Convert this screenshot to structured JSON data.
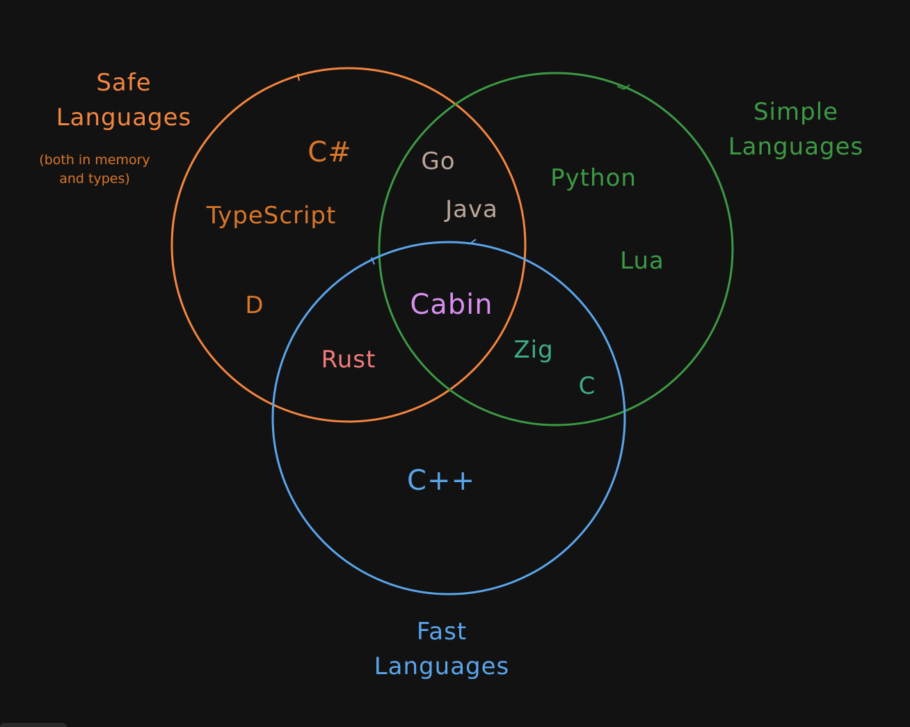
{
  "colors": {
    "background": "#121212",
    "safe": "#f4863f",
    "safe_text": "#d9772a",
    "simple": "#3d9a45",
    "fast": "#5aa6ec",
    "overlap_safe_simple": "#bca79b",
    "rust": "#f07b7b",
    "cabin": "#d88ff0",
    "zig_c": "#3fae86"
  },
  "sets": {
    "safe": {
      "title_line1": "Safe",
      "title_line2": "Languages",
      "note_line1": "(both in memory",
      "note_line2": "and types)"
    },
    "simple": {
      "title_line1": "Simple",
      "title_line2": "Languages"
    },
    "fast": {
      "title_line1": "Fast",
      "title_line2": "Languages"
    }
  },
  "languages": {
    "csharp": "C#",
    "typescript": "TypeScript",
    "d": "D",
    "go": "Go",
    "java": "Java",
    "python": "Python",
    "lua": "Lua",
    "cabin": "Cabin",
    "rust": "Rust",
    "zig": "Zig",
    "c": "C",
    "cpp": "C++"
  }
}
